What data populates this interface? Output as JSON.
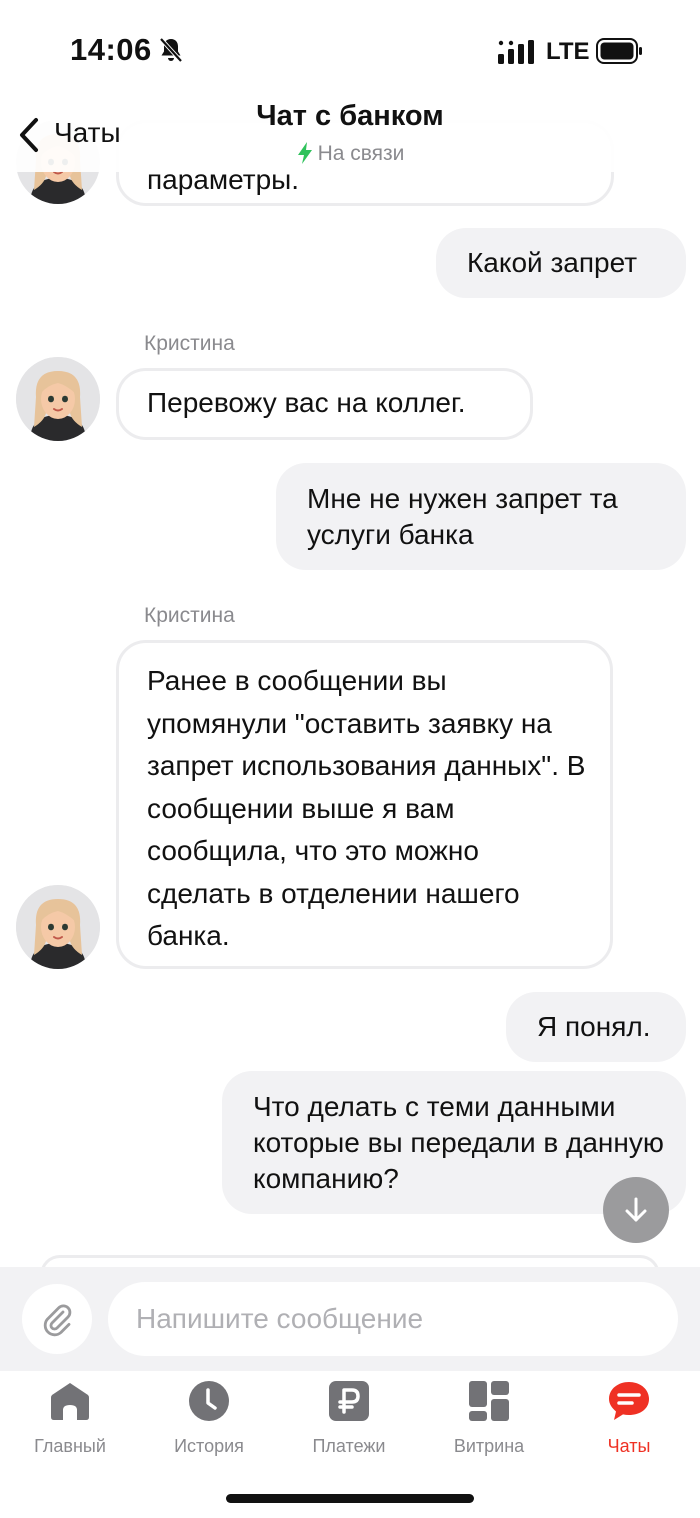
{
  "status_bar": {
    "time": "14:06",
    "network": "LTE"
  },
  "header": {
    "back_label": "Чаты",
    "title": "Чат с банком",
    "status": "На связи"
  },
  "messages": [
    {
      "from": "bank",
      "sender": "",
      "text": "параметры."
    },
    {
      "from": "user",
      "text": "Какой запрет"
    },
    {
      "from": "bank",
      "sender": "Кристина",
      "text": "Перевожу вас на коллег."
    },
    {
      "from": "user",
      "text": "Мне не нужен запрет та услуги банка"
    },
    {
      "from": "bank",
      "sender": "Кристина",
      "text": "Ранее в сообщении вы упомянули \"оставить заявку на запрет использования данных\". В сообщении выше я вам сообщила, что это можно сделать в отделении нашего банка."
    },
    {
      "from": "user",
      "text": "Я понял."
    },
    {
      "from": "user",
      "text": "Что делать с теми данными которые вы передали в данную компанию?"
    }
  ],
  "composer": {
    "placeholder": "Напишите сообщение"
  },
  "tabs": [
    {
      "label": "Главный",
      "icon": "home-icon",
      "active": false
    },
    {
      "label": "История",
      "icon": "clock-icon",
      "active": false
    },
    {
      "label": "Платежи",
      "icon": "ruble-icon",
      "active": false
    },
    {
      "label": "Витрина",
      "icon": "grid-icon",
      "active": false
    },
    {
      "label": "Чаты",
      "icon": "chat-icon",
      "active": true
    }
  ],
  "colors": {
    "accent": "#ef3124",
    "online": "#2fc25b",
    "bubble_user": "#f2f2f4",
    "muted": "#8a8a8e"
  }
}
